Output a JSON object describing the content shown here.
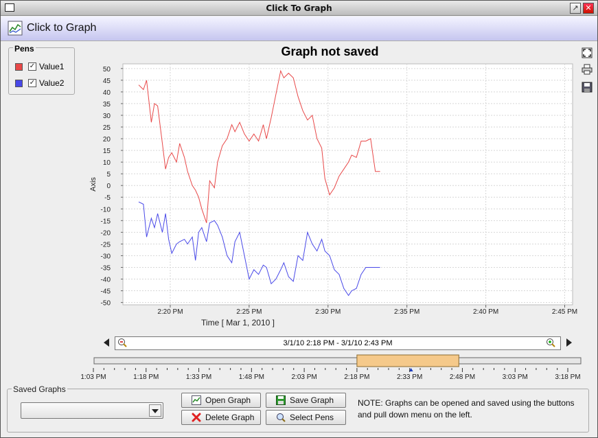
{
  "window": {
    "title": "Click To Graph"
  },
  "header": {
    "title": "Click to Graph"
  },
  "pens": {
    "label": "Pens",
    "items": [
      {
        "name": "Value1",
        "color": "#e84848",
        "checked": true
      },
      {
        "name": "Value2",
        "color": "#4848e8",
        "checked": true
      }
    ]
  },
  "chart": {
    "title": "Graph not saved",
    "ylabel": "Axis",
    "xlabel": "Time  [ Mar 1, 2010 ]"
  },
  "chart_data": {
    "type": "line",
    "title": "Graph not saved",
    "ylabel": "Axis",
    "xlabel": "Time  [ Mar 1, 2010 ]",
    "ylim": [
      -51,
      52
    ],
    "xlim": [
      "2:17 PM",
      "2:45 PM"
    ],
    "yticks": [
      50,
      45,
      40,
      35,
      30,
      25,
      20,
      15,
      10,
      5,
      0,
      -5,
      -10,
      -15,
      -20,
      -25,
      -30,
      -35,
      -40,
      -45,
      -50
    ],
    "xticks": [
      "2:20 PM",
      "2:25 PM",
      "2:30 PM",
      "2:35 PM",
      "2:40 PM",
      "2:45 PM"
    ],
    "xtick_minutes": [
      20,
      25,
      30,
      35,
      40,
      45
    ],
    "grid": true,
    "series": [
      {
        "name": "Value1",
        "color": "#e84848",
        "x": [
          18.0,
          18.3,
          18.5,
          18.8,
          19.0,
          19.2,
          19.5,
          19.7,
          19.9,
          20.1,
          20.4,
          20.6,
          20.9,
          21.1,
          21.4,
          21.6,
          21.8,
          22.0,
          22.3,
          22.5,
          22.8,
          23.0,
          23.3,
          23.6,
          23.9,
          24.1,
          24.4,
          24.7,
          25.0,
          25.3,
          25.6,
          25.9,
          26.1,
          26.4,
          26.7,
          27.0,
          27.2,
          27.5,
          27.8,
          28.1,
          28.4,
          28.7,
          29.0,
          29.3,
          29.6,
          29.8,
          30.1,
          30.4,
          30.7,
          31.0,
          31.3,
          31.5,
          31.8,
          32.1,
          32.4,
          32.7,
          33.0,
          33.3
        ],
        "values": [
          43,
          41,
          45,
          27,
          35,
          34,
          18,
          7,
          12,
          14,
          10,
          18,
          12,
          6,
          0,
          -2,
          -5,
          -10,
          -16,
          2,
          -1,
          10,
          17,
          20,
          26,
          23,
          27,
          22,
          19,
          22,
          19,
          26,
          20,
          29,
          39,
          49,
          46,
          48,
          46,
          38,
          32,
          28,
          30,
          20,
          16,
          3,
          -4,
          -1,
          4,
          7,
          10,
          13,
          12,
          19,
          19,
          20,
          6,
          6
        ]
      },
      {
        "name": "Value2",
        "color": "#4848e8",
        "x": [
          18.0,
          18.3,
          18.5,
          18.8,
          19.0,
          19.2,
          19.5,
          19.7,
          19.9,
          20.1,
          20.4,
          20.6,
          20.9,
          21.1,
          21.4,
          21.6,
          21.8,
          22.0,
          22.3,
          22.5,
          22.8,
          23.0,
          23.3,
          23.6,
          23.9,
          24.1,
          24.4,
          24.7,
          25.0,
          25.3,
          25.6,
          25.9,
          26.1,
          26.4,
          26.7,
          27.0,
          27.2,
          27.5,
          27.8,
          28.1,
          28.4,
          28.7,
          29.0,
          29.3,
          29.6,
          29.8,
          30.1,
          30.4,
          30.7,
          31.0,
          31.3,
          31.5,
          31.8,
          32.1,
          32.4,
          32.7,
          33.0,
          33.3
        ],
        "values": [
          -7,
          -8,
          -22,
          -14,
          -18,
          -12,
          -20,
          -12,
          -23,
          -29,
          -25,
          -24,
          -23,
          -25,
          -22,
          -32,
          -20,
          -18,
          -24,
          -16,
          -15,
          -17,
          -22,
          -30,
          -33,
          -24,
          -20,
          -30,
          -40,
          -36,
          -38,
          -34,
          -35,
          -42,
          -40,
          -36,
          -33,
          -39,
          -41,
          -30,
          -32,
          -20,
          -25,
          -28,
          -23,
          -28,
          -30,
          -36,
          -38,
          -44,
          -47,
          -45,
          -44,
          -38,
          -35,
          -35,
          -35,
          -35
        ]
      }
    ]
  },
  "navigator": {
    "range_text": "3/1/10 2:18 PM - 3/1/10 2:43 PM",
    "timeline_ticks": [
      "1:03 PM",
      "1:18 PM",
      "1:33 PM",
      "1:48 PM",
      "2:03 PM",
      "2:18 PM",
      "2:33 PM",
      "2:48 PM",
      "3:03 PM",
      "3:18 PM"
    ],
    "selection_start": "2:18 PM",
    "selection_end": "2:47 PM",
    "selection_color": "#f5c98a"
  },
  "saved_graphs": {
    "label": "Saved Graphs",
    "selected": "",
    "open_label": "Open Graph",
    "save_label": "Save Graph",
    "delete_label": "Delete Graph",
    "select_pens_label": "Select Pens",
    "note": "NOTE: Graphs can be opened and saved using the buttons and pull down menu on the left."
  }
}
